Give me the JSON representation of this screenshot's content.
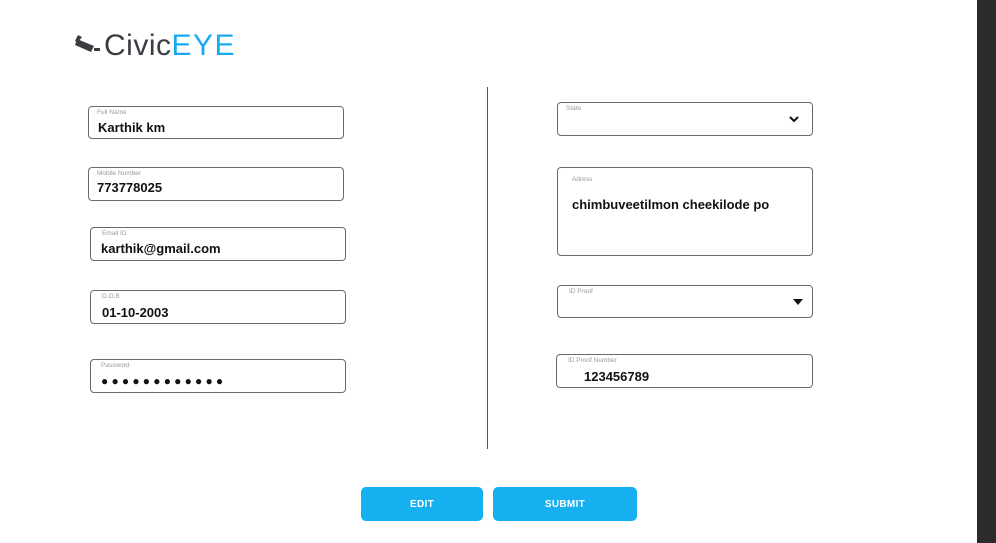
{
  "brand": {
    "part1": "Civic",
    "part2": "EYE"
  },
  "form": {
    "full_name": {
      "label": "Full Name",
      "value": "Karthik km"
    },
    "mobile": {
      "label": "Mobile Number",
      "value": "773778025"
    },
    "email": {
      "label": "Email ID",
      "value": "karthik@gmail.com"
    },
    "dob": {
      "label": "D.O.B",
      "value": "01-10-2003"
    },
    "password": {
      "label": "Password",
      "value": "●●●●●●●●●●●●"
    },
    "state": {
      "label": "State",
      "value": ""
    },
    "address": {
      "label": "Adress",
      "value": "chimbuveetilmon cheekilode po"
    },
    "id_proof": {
      "label": "ID Proof",
      "value": ""
    },
    "id_number": {
      "label": "ID Proof Number",
      "value": "123456789"
    }
  },
  "buttons": {
    "edit": "EDIT",
    "submit": "SUBMIT"
  },
  "colors": {
    "accent": "#16aff0",
    "logo_dark": "#3c3c44",
    "sidebar": "#2b2b2b"
  },
  "icons": {
    "logo": "cctv-camera-icon",
    "state_dropdown": "chevron-down-icon",
    "id_proof_dropdown": "caret-down-icon"
  }
}
